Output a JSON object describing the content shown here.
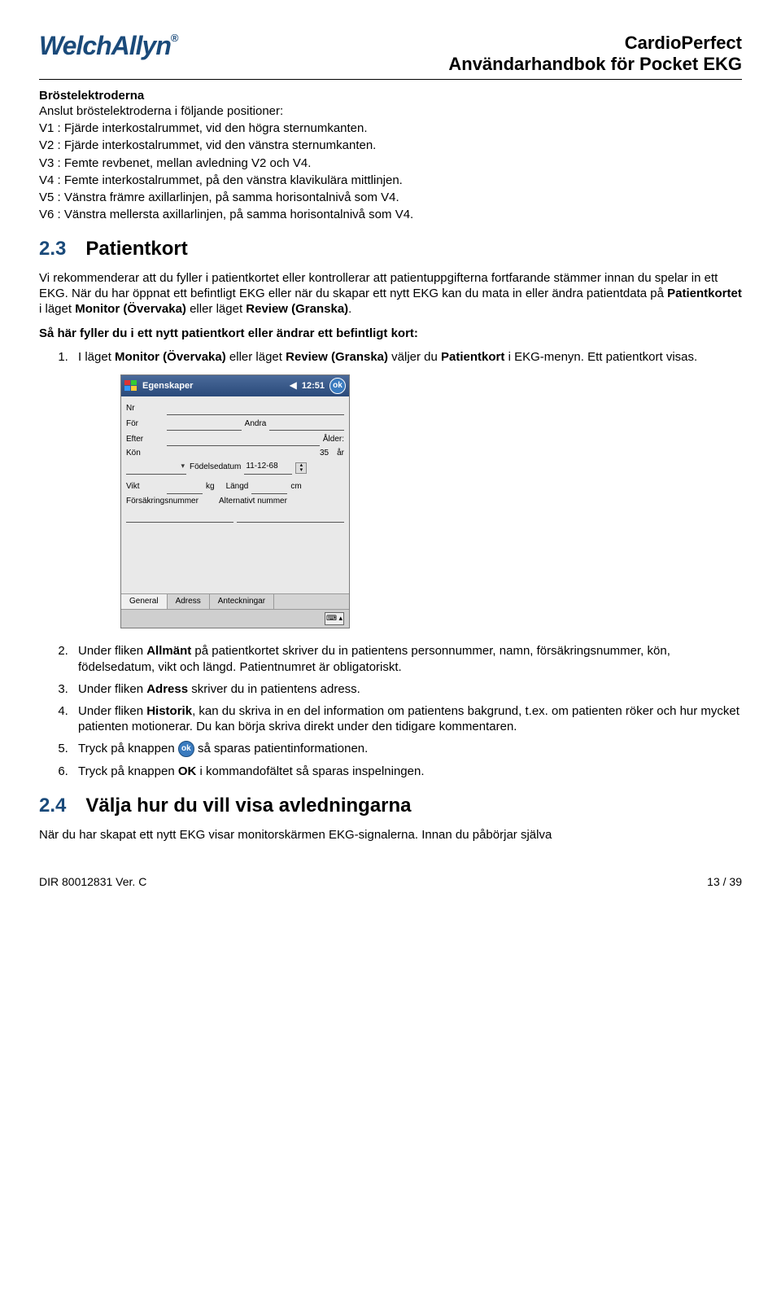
{
  "header": {
    "logo_text": "WelchAllyn",
    "reg": "®",
    "doc_title_1": "CardioPerfect",
    "doc_title_2": "Användarhandbok för Pocket EKG"
  },
  "electrodes": {
    "title": "Bröstelektroderna",
    "intro": "Anslut bröstelektroderna i följande positioner:",
    "v1": "V1 : Fjärde interkostalrummet, vid den högra sternumkanten.",
    "v2": "V2 : Fjärde interkostalrummet, vid den vänstra sternumkanten.",
    "v3": "V3 : Femte revbenet, mellan avledning V2 och V4.",
    "v4": "V4 : Femte interkostalrummet, på den vänstra klavikulära mittlinjen.",
    "v5": "V5 : Vänstra främre axillarlinjen, på samma horisontalnivå som V4.",
    "v6": "V6 : Vänstra mellersta axillarlinjen, på samma horisontalnivå som V4."
  },
  "section_2_3": {
    "num": "2.3",
    "title": "Patientkort",
    "para1a": "Vi rekommenderar att du fyller i patientkortet eller kontrollerar att patientuppgifterna fortfarande stämmer innan du spelar in ett EKG. När du har öppnat ett befintligt EKG eller när du skapar ett nytt EKG kan du mata in eller ändra patientdata på ",
    "para1b": "Patientkortet",
    "para1c": " i läget ",
    "para1d": "Monitor (Övervaka)",
    "para1e": " eller läget ",
    "para1f": "Review (Granska)",
    "para1g": ".",
    "subhead": "Så här fyller du i ett nytt patientkort eller ändrar ett befintligt kort:",
    "step1a": "I läget ",
    "step1b": "Monitor (Övervaka)",
    "step1c": " eller läget ",
    "step1d": "Review (Granska)",
    "step1e": " väljer du ",
    "step1f": "Patientkort",
    "step1g": " i EKG-menyn. Ett patientkort visas.",
    "step2a": "Under fliken ",
    "step2b": "Allmänt",
    "step2c": " på patientkortet skriver du in patientens personnummer, namn, försäkringsnummer, kön, födelsedatum, vikt och längd. Patientnumret är obligatoriskt.",
    "step3a": "Under fliken ",
    "step3b": "Adress",
    "step3c": " skriver du in patientens adress.",
    "step4a": "Under fliken ",
    "step4b": "Historik",
    "step4c": ", kan du skriva in en del information om patientens bakgrund, t.ex. om patienten röker och hur mycket patienten motionerar. Du kan börja skriva direkt under den tidigare kommentaren.",
    "step5a": "Tryck på knappen ",
    "step5b": " så sparas patientinformationen.",
    "step6a": "Tryck på knappen ",
    "step6b": "OK",
    "step6c": " i kommandofältet så sparas inspelningen."
  },
  "section_2_4": {
    "num": "2.4",
    "title": "Välja hur du vill visa avledningarna",
    "para": "När du har skapat ett nytt EKG visar monitorskärmen EKG-signalerna. Innan du påbörjar själva"
  },
  "ppc": {
    "title": "Egenskaper",
    "clock": "12:51",
    "ok": "ok",
    "labels": {
      "nr": "Nr",
      "for": "För",
      "andra": "Andra",
      "efter": "Efter",
      "alder": "Ålder:",
      "alder_val": "35",
      "ar": "år",
      "kon": "Kön",
      "fodelsedatum": "Födelsedatum",
      "fodelsedatum_val": "11-12-68",
      "vikt": "Vikt",
      "kg": "kg",
      "langd": "Längd",
      "cm": "cm",
      "forsakring": "Försäkringsnummer",
      "alternativt": "Alternativt nummer"
    },
    "tabs": {
      "general": "General",
      "adress": "Adress",
      "anteck": "Anteckningar"
    }
  },
  "footer": {
    "left": "DIR 80012831 Ver. C",
    "right": "13 / 39"
  }
}
